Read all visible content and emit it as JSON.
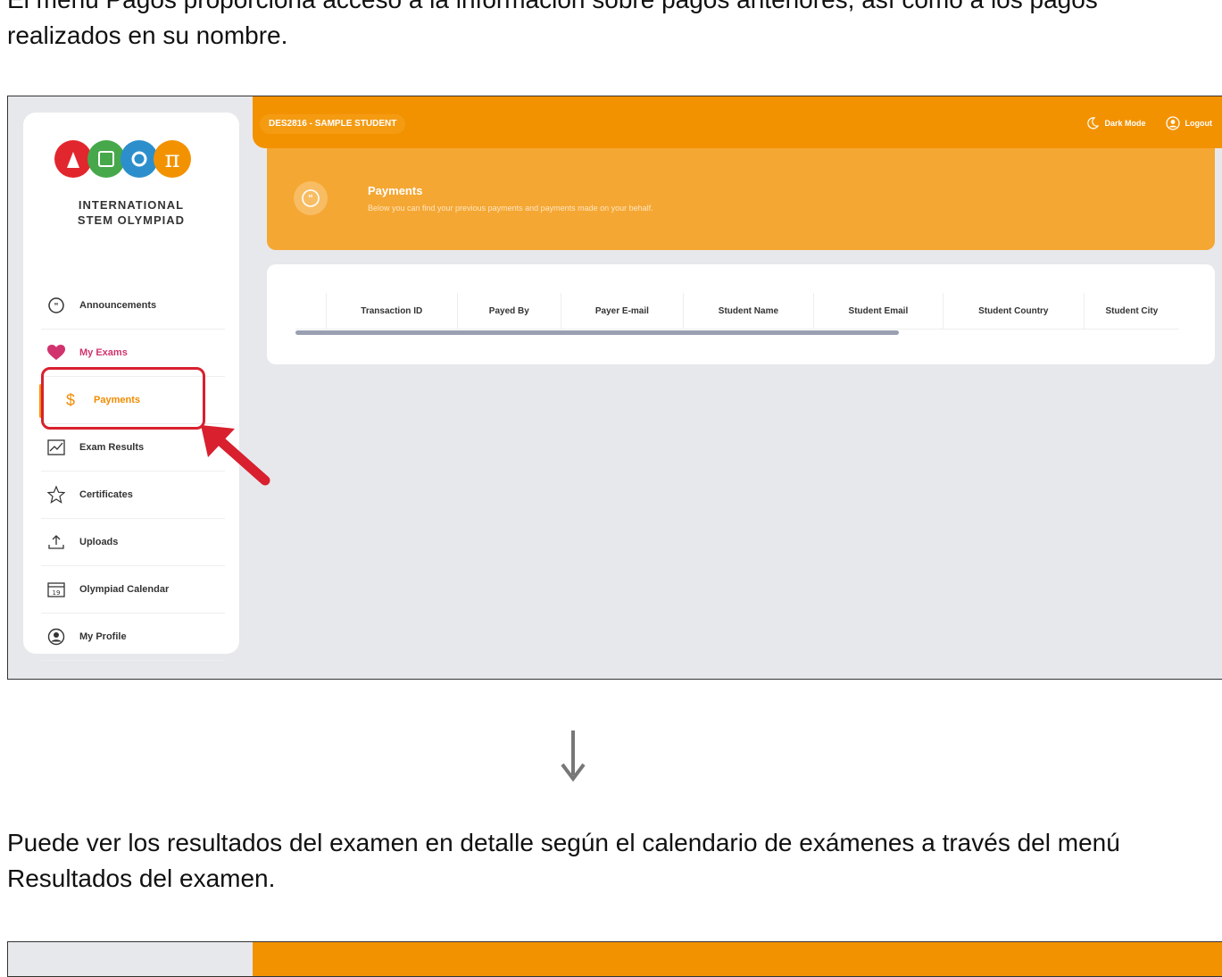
{
  "doc": {
    "intro_text": "El menú Pagos proporciona acceso a la información sobre pagos anteriores, así como a los pagos realizados en su nombre.",
    "next_text": "Puede ver los resultados del examen en detalle según el calendario de exámenes a través del menú Resultados del examen."
  },
  "app": {
    "logo_line1": "INTERNATIONAL",
    "logo_line2": "STEM OLYMPIAD",
    "user_badge": "DES2816 - SAMPLE STUDENT",
    "dark_mode_label": "Dark Mode",
    "logout_label": "Logout",
    "accent_color": "#f39200"
  },
  "sidebar": {
    "items": [
      {
        "label": "Announcements",
        "icon": "quote-bubble-icon"
      },
      {
        "label": "My Exams",
        "icon": "heart-icon"
      },
      {
        "label": "Payments",
        "icon": "dollar-icon",
        "active": true
      },
      {
        "label": "Exam Results",
        "icon": "chart-line-icon"
      },
      {
        "label": "Certificates",
        "icon": "star-icon"
      },
      {
        "label": "Uploads",
        "icon": "upload-icon"
      },
      {
        "label": "Olympiad Calendar",
        "icon": "calendar-icon"
      },
      {
        "label": "My Profile",
        "icon": "user-circle-icon"
      }
    ]
  },
  "page": {
    "title": "Payments",
    "subtitle": "Below you can find your previous payments and payments made on your behalf."
  },
  "table": {
    "columns": [
      "",
      "Transaction ID",
      "Payed By",
      "Payer E-mail",
      "Student Name",
      "Student Email",
      "Student Country",
      "Student City"
    ],
    "rows": []
  }
}
